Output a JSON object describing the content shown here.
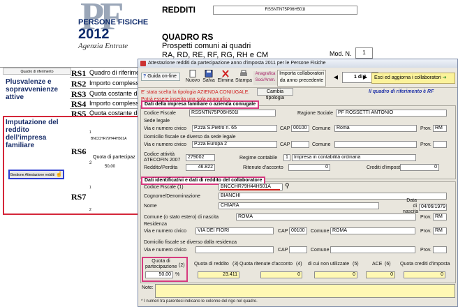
{
  "background": {
    "logo_title": "PERSONE FISICHE",
    "logo_year": "2012",
    "logo_agency": "Agenzia Entrate",
    "header": "REDDITI",
    "quadro_title": "QUADRO RS",
    "quadro_desc_1": "Prospetti comuni ai quadri",
    "quadro_desc_2": "RA, RD, RE, RF, RG, RH e CM",
    "codice_fiscale": "RSSNTN75P06H501I",
    "mod_label": "Mod. N.",
    "mod_value": "1",
    "table_header": "Quadro di riferimento",
    "left_labels": {
      "plus": "Plusvalenze e sopravvenienze attive",
      "imputazione": "Imputazione del reddito dell’impresa familiare"
    },
    "rows": [
      {
        "code": "RS1",
        "desc": "Quadro di riferimento"
      },
      {
        "code": "RS2",
        "desc": "Importo complessivo"
      },
      {
        "code": "RS3",
        "desc": "Quota costante dell"
      },
      {
        "code": "RS4",
        "desc": "Importo complessivo"
      },
      {
        "code": "RS5",
        "desc": "Quota costante degli"
      },
      {
        "code": "RS6",
        "desc": ""
      },
      {
        "code": "RS7",
        "desc": ""
      }
    ],
    "rs6_cf": "BNCCHR79H44H501A",
    "rs6_one": "1",
    "rs6_two": "2",
    "rs6_quota_label": "Quota di partecipaz",
    "rs6_quota": "50,00",
    "rs7_one": "1",
    "rs7_two": "2",
    "gestione": "Gestione Attestazione redditi"
  },
  "dialog": {
    "title": "Attestazione redditi da partecipazione anno d'imposta 2011 per le Persone Fisiche",
    "toolbar": {
      "guida": "Guida on-line",
      "nuovo": "Nuovo",
      "salva": "Salva",
      "elimina": "Elimina",
      "stampa": "Stampa",
      "anagrafica": "Anagrafica Soci/Amm.",
      "importa": "Importa collaboratori da anno precedente",
      "pager": "1 di 1",
      "esci": "Esci ed aggiorna i collaboratori"
    },
    "msg_tipologia": "E' stata scelta la tipologia AZIENDA CONIUGALE.",
    "msg_anagrafica": "Potrà essere inserita una sola anagrafica.",
    "cambia": "Cambia tipologia",
    "quadro_rif": "Il quadro di riferimento è RF",
    "impresa": {
      "title": "Dati della impresa familiare o azienda coniugale",
      "cf_label": "Codice Fiscale",
      "cf": "RSSNTN75P06H501I",
      "ragione_label": "Ragione Sociale",
      "ragione": "PF ROSSETTI ANTONIO",
      "sede_legale": "Sede legale",
      "via_label": "Via e numero civico",
      "via": "P.zza S.Pietro n. 65",
      "cap_label": "CAP",
      "cap": "00100",
      "comune_label": "Comune",
      "comune": "Roma",
      "prov_label": "Prov.",
      "prov": "RM",
      "domicilio_label": "Domicilio fiscale se diverso da sede legale",
      "via2": "P.zza Europa 2",
      "codice_att_label": "Codice attività ATECOFIN 2007",
      "codice_att": "279002",
      "regime_label": "Regime contabile",
      "regime_code": "1",
      "regime": "Impresa in contabilità ordinaria",
      "reddito_label": "Reddito/Perdita",
      "reddito": "46.822",
      "ritenute_label": "Ritenute d'acconto",
      "ritenute": "0",
      "crediti_label": "Crediti d'imposta",
      "crediti": "0"
    },
    "collab": {
      "title": "Dati identificativi e dati di reddito del collaboratore",
      "cf_label": "Codice Fiscale",
      "cf_col": "(1)",
      "cf": "BNCCHR79H44H501A",
      "cognome_label": "Cognome/Denominazione",
      "cognome": "BIANCHI",
      "nome_label": "Nome",
      "nome": "CHIARA",
      "nascita_label": "Data di nascita",
      "nascita": "04/06/1979",
      "comune_nascita_label": "Comune (o stato estero) di nascita",
      "comune_nascita": "ROMA",
      "prov_label": "Prov.",
      "prov": "RM",
      "residenza": "Residenza",
      "via_label": "Via e numero civico",
      "via": "VIA DEI FIORI",
      "cap_label": "CAP",
      "cap": "00100",
      "comune_label": "Comune",
      "comune": "ROMA",
      "prov2": "RM",
      "domicilio_label": "Domicilio fiscale se diverso dalla residenza",
      "via2_label": "Via e numero civico",
      "cap2_label": "CAP",
      "comune2_label": "Comune",
      "prov3_label": "Prov.",
      "quota_part_label": "Quota di partecipazione",
      "quota_part_col": "(2)",
      "quota_part": "50,00",
      "quota_part_unit": "%",
      "quota_reddito_label": "Quota di reddito",
      "quota_reddito_col": "(3)",
      "quota_reddito": "23.411",
      "quota_rit_label": "Quota ritenute d'acconto",
      "quota_rit_col": "(4)",
      "quota_rit": "0",
      "non_util_label": "di cui non utilizzate",
      "non_util_col": "(5)",
      "non_util": "0",
      "ace_label": "ACE",
      "ace_col": "(6)",
      "ace": "0",
      "quota_crediti_label": "Quota crediti d'imposta",
      "quota_crediti": "0"
    },
    "note_label": "Note:",
    "hint": "* I numeri tra parentesi indicano le colonne del rigo nel quadro."
  }
}
